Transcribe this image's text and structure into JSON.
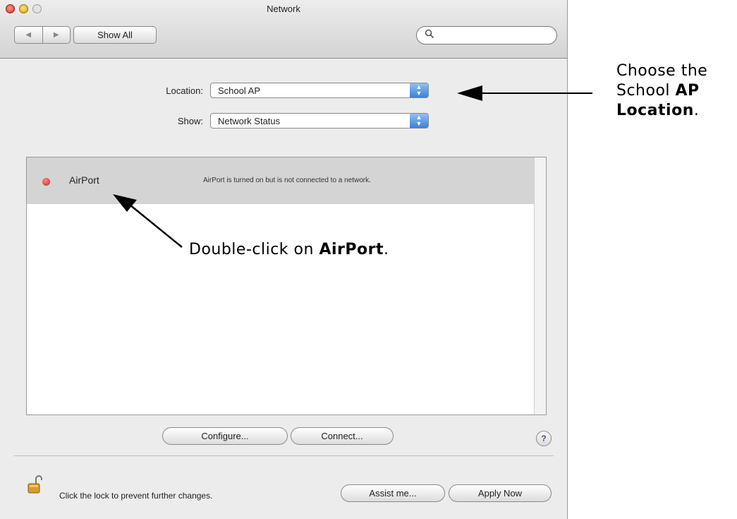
{
  "window": {
    "title": "Network",
    "nav_back": "◀",
    "nav_forward": "▶",
    "show_all_label": "Show All",
    "search_placeholder": ""
  },
  "form": {
    "location_label": "Location:",
    "location_value": "School AP",
    "show_label": "Show:",
    "show_value": "Network Status"
  },
  "list": {
    "rows": [
      {
        "name": "AirPort",
        "status": "AirPort is turned on but is not connected to a network.",
        "status_color": "#c51f14"
      }
    ]
  },
  "buttons": {
    "configure": "Configure...",
    "connect": "Connect...",
    "help": "?",
    "assist": "Assist me...",
    "apply": "Apply Now"
  },
  "footer": {
    "lock_text": "Click the lock to prevent further changes."
  },
  "annotations": {
    "location_note": {
      "line1": "Choose the",
      "line2_a": "School ",
      "line2_b": "AP",
      "line3_a": "Location",
      "line3_b": "."
    },
    "airport_note": {
      "a": "Double-click on ",
      "b": "AirPort",
      "c": "."
    }
  },
  "colors": {
    "accent": "#3d7fd8",
    "selected_row": "#d4d4d4"
  }
}
